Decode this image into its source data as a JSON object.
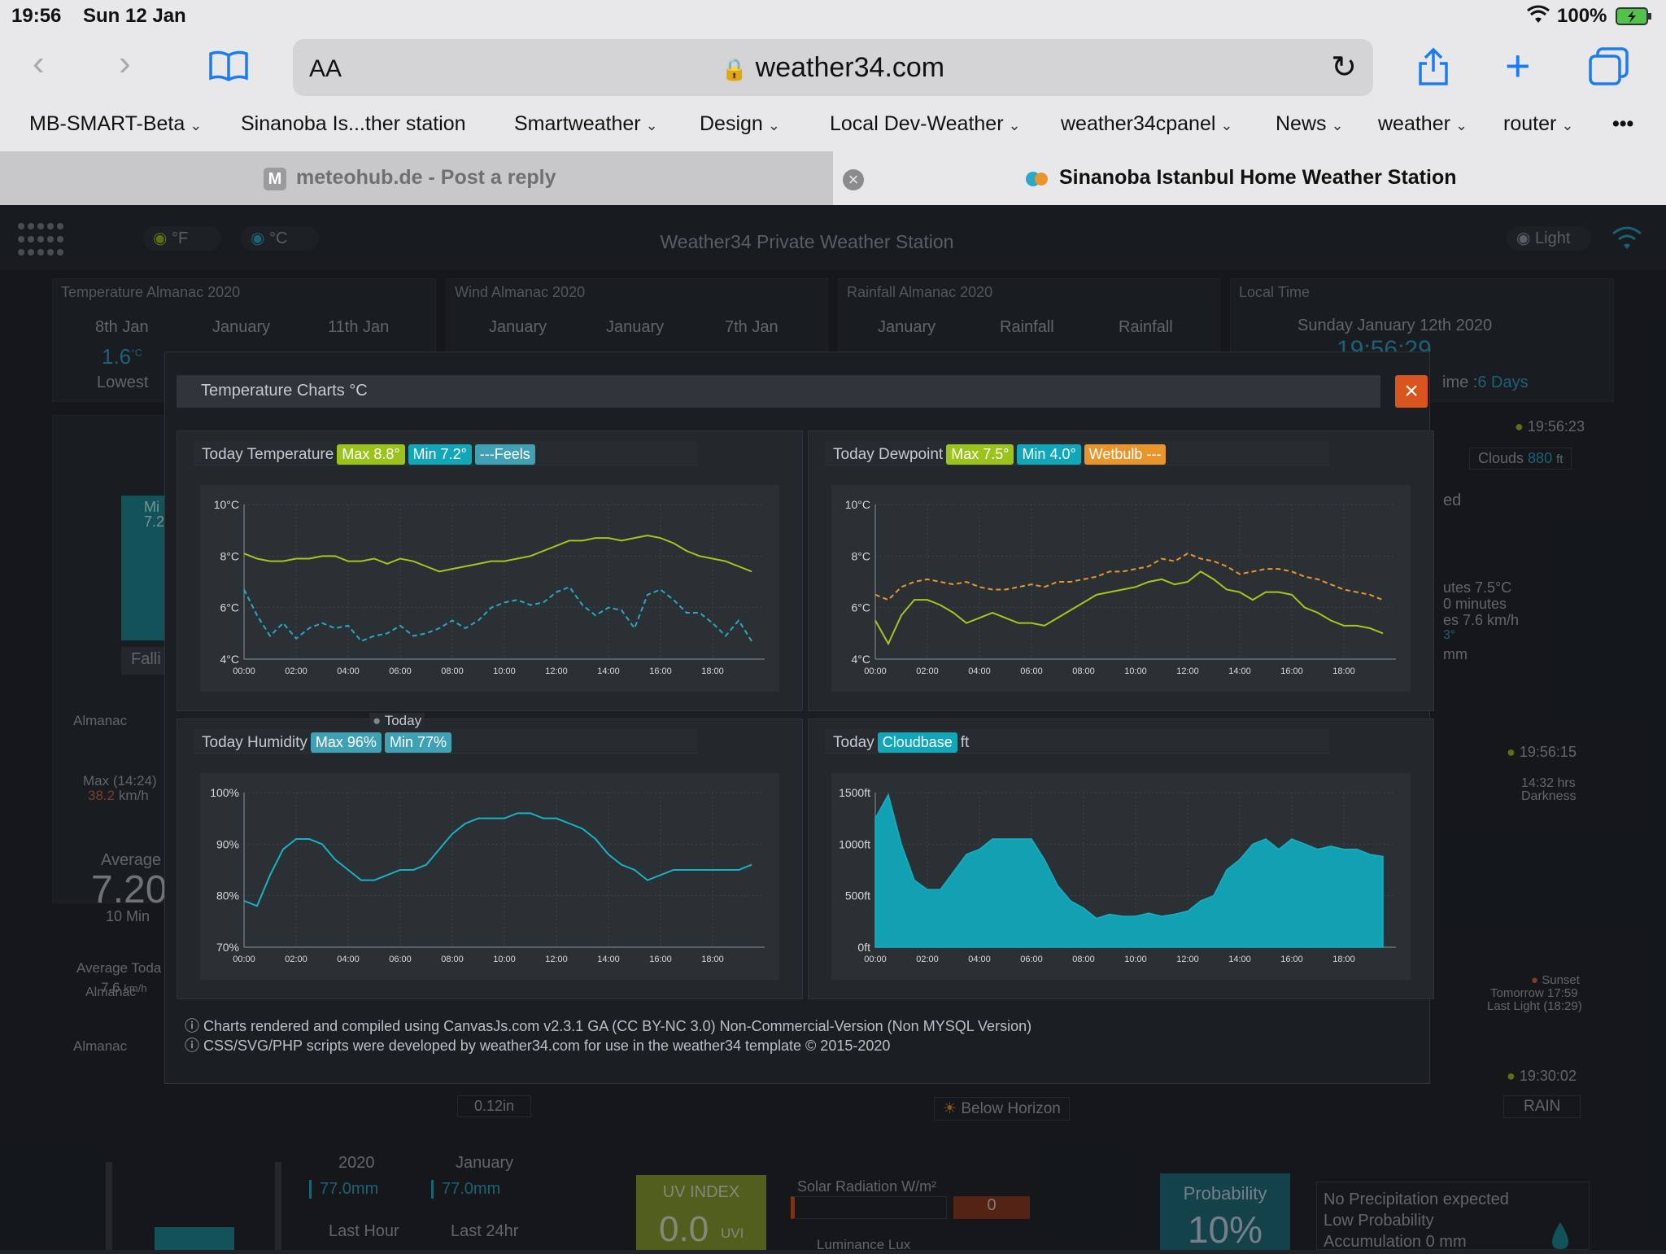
{
  "status": {
    "time": "19:56",
    "date": "Sun 12 Jan",
    "battery": "100%"
  },
  "browser": {
    "url": "weather34.com",
    "text_size_label": "AA",
    "bookmarks": [
      {
        "label": "MB-SMART-Beta",
        "chevron": true
      },
      {
        "label": "Sinanoba Is...ther station",
        "chevron": false
      },
      {
        "label": "Smartweather",
        "chevron": true
      },
      {
        "label": "Design",
        "chevron": true
      },
      {
        "label": "Local Dev-Weather",
        "chevron": true
      },
      {
        "label": "weather34cpanel",
        "chevron": true
      },
      {
        "label": "News",
        "chevron": true
      },
      {
        "label": "weather",
        "chevron": true
      },
      {
        "label": "router",
        "chevron": true
      }
    ],
    "more_label": "•••",
    "tabs": [
      {
        "label": "meteohub.de - Post a reply",
        "icon_letter": "M",
        "active": false
      },
      {
        "label": "Sinanoba Istanbul Home Weather Station",
        "active": true
      }
    ]
  },
  "dashboard": {
    "title": "Weather34 Private Weather Station",
    "unit_f": "°F",
    "unit_c": "°C",
    "theme_label": "Light",
    "panels": [
      {
        "title": "Temperature Almanac 2020",
        "cols": [
          "8th Jan",
          "January",
          "11th Jan"
        ],
        "value": "1.6",
        "unit": "°C",
        "note": "Lowest"
      },
      {
        "title": "Wind Almanac 2020",
        "cols": [
          "January",
          "January",
          "7th Jan"
        ]
      },
      {
        "title": "Rainfall Almanac 2020",
        "cols": [
          "January",
          "Rainfall",
          "Rainfall"
        ]
      },
      {
        "title": "Local Time",
        "date": "Sunday January 12th 2020",
        "time": "19:56:29",
        "uptime_label": "ime :",
        "uptime_value": "6 Days"
      }
    ],
    "side": {
      "time1": "19:56:23",
      "clouds_label": "Clouds",
      "clouds_value": "880",
      "clouds_unit": "ft",
      "ed": "ed",
      "lines": [
        "utes 7.5°C",
        "0 minutes",
        "es 7.6 km/h",
        "3°",
        "mm"
      ],
      "time2": "19:56:15",
      "darkness": "14:32 hrs",
      "darkness_label": "Darkness",
      "sunset_label": "Sunset",
      "sunset_tomorrow": "Tomorrow 17:59",
      "last_light": "Last Light (18:29)",
      "time3": "19:30:02",
      "rain_label": "RAIN"
    },
    "left": {
      "almanac": "Almanac",
      "falling": "Falli",
      "mi": "Mi",
      "mi_val": "7.2",
      "max_label": "Max (14:24)",
      "max_value": "38.2",
      "max_unit": "km/h",
      "avg_label": "Average",
      "avg_value": "7.20",
      "avg_period": "10 Min",
      "avg_today_label": "Average Toda",
      "avg_today_value": "7.6",
      "avg_today_unit": "km/h",
      "almanac2": "Almanac"
    },
    "bottom": {
      "rain_in": "0.12in",
      "year": "2020",
      "month": "January",
      "year_val": "77.0mm",
      "month_val": "77.0mm",
      "last_hour": "Last Hour",
      "last_24": "Last 24hr",
      "below_horizon": "Below Horizon",
      "uv_label": "UV INDEX",
      "uv_value": "0.0",
      "uv_unit": "UVI",
      "solar_label": "Solar Radiation W/m²",
      "solar_value": "0",
      "lux_label": "Luminance Lux",
      "prob_label": "Probability",
      "prob_value": "10%",
      "precip_line": "No Precipitation expected",
      "low_prob": "Low Probability",
      "accum": "Accumulation 0 mm"
    }
  },
  "modal": {
    "title": "Temperature Charts °C",
    "close": "×",
    "today_label": "Today",
    "footnotes": [
      "ⓘ Charts rendered and compiled using CanvasJs.com v2.3.1 GA (CC BY-NC 3.0) Non-Commercial-Version (Non MYSQL Version)",
      "ⓘ CSS/SVG/PHP scripts were developed by weather34.com for use in the weather34 template © 2015-2020"
    ],
    "charts": [
      {
        "caption": "Today Temperature",
        "badges": [
          {
            "text": "Max 8.8°",
            "color": "#9ac31c"
          },
          {
            "text": "Min 7.2°",
            "color": "#12a6b9"
          },
          {
            "text": "---Feels",
            "color": "#3fa1b3"
          }
        ]
      },
      {
        "caption": "Today Dewpoint",
        "badges": [
          {
            "text": "Max 7.5°",
            "color": "#9ac31c"
          },
          {
            "text": "Min 4.0°",
            "color": "#12a6b9"
          },
          {
            "text": "Wetbulb ---",
            "color": "#e8962c"
          }
        ]
      },
      {
        "caption": "Today Humidity",
        "badges": [
          {
            "text": "Max 96%",
            "color": "#3fa1b3"
          },
          {
            "text": "Min 77%",
            "color": "#3fa1b3"
          }
        ]
      },
      {
        "caption": "Today",
        "badges": [
          {
            "text": "Cloudbase",
            "color": "#12a6b9"
          }
        ],
        "suffix": "ft"
      }
    ]
  },
  "chart_data": [
    {
      "type": "line",
      "y_ticks": [
        "4°C",
        "6°C",
        "8°C",
        "10°C"
      ],
      "ylim": [
        4,
        10
      ],
      "x_ticks": [
        "00:00",
        "02:00",
        "04:00",
        "06:00",
        "08:00",
        "10:00",
        "12:00",
        "14:00",
        "16:00",
        "18:00"
      ],
      "x": [
        0,
        0.5,
        1,
        1.5,
        2,
        2.5,
        3,
        3.5,
        4,
        4.5,
        5,
        5.5,
        6,
        6.5,
        7,
        7.5,
        8,
        8.5,
        9,
        9.5,
        10,
        10.5,
        11,
        11.5,
        12,
        12.5,
        13,
        13.5,
        14,
        14.5,
        15,
        15.5,
        16,
        16.5,
        17,
        17.5,
        18,
        18.5,
        19,
        19.5
      ],
      "series": [
        {
          "color": "#a7c51a",
          "dashed": false,
          "values": [
            8.1,
            7.9,
            7.8,
            7.8,
            7.9,
            7.9,
            8.0,
            8.0,
            7.8,
            7.8,
            7.9,
            7.7,
            7.9,
            7.8,
            7.6,
            7.4,
            7.5,
            7.6,
            7.7,
            7.8,
            7.8,
            7.9,
            8.0,
            8.2,
            8.4,
            8.6,
            8.6,
            8.7,
            8.7,
            8.6,
            8.7,
            8.8,
            8.7,
            8.5,
            8.2,
            8.0,
            7.9,
            7.8,
            7.6,
            7.4
          ]
        },
        {
          "color": "#2aa8c0",
          "dashed": true,
          "values": [
            6.7,
            5.7,
            4.9,
            5.4,
            4.8,
            5.2,
            5.4,
            5.2,
            5.3,
            4.7,
            4.9,
            5.0,
            5.3,
            4.9,
            5.0,
            5.2,
            5.5,
            5.2,
            5.5,
            6.0,
            6.2,
            6.3,
            6.1,
            6.2,
            6.6,
            6.8,
            6.1,
            5.7,
            6.0,
            5.9,
            5.2,
            6.5,
            6.7,
            6.3,
            5.8,
            5.8,
            5.4,
            4.9,
            5.5,
            4.7
          ]
        }
      ]
    },
    {
      "type": "line",
      "y_ticks": [
        "4°C",
        "6°C",
        "8°C",
        "10°C"
      ],
      "ylim": [
        4,
        10
      ],
      "x_ticks": [
        "00:00",
        "02:00",
        "04:00",
        "06:00",
        "08:00",
        "10:00",
        "12:00",
        "14:00",
        "16:00",
        "18:00"
      ],
      "x": [
        0,
        0.5,
        1,
        1.5,
        2,
        2.5,
        3,
        3.5,
        4,
        4.5,
        5,
        5.5,
        6,
        6.5,
        7,
        7.5,
        8,
        8.5,
        9,
        9.5,
        10,
        10.5,
        11,
        11.5,
        12,
        12.5,
        13,
        13.5,
        14,
        14.5,
        15,
        15.5,
        16,
        16.5,
        17,
        17.5,
        18,
        18.5,
        19,
        19.5
      ],
      "series": [
        {
          "color": "#e8962c",
          "dashed": true,
          "values": [
            6.5,
            6.3,
            6.8,
            7.0,
            7.1,
            7.0,
            6.9,
            7.0,
            6.8,
            6.7,
            6.7,
            6.8,
            6.9,
            6.8,
            7.0,
            7.0,
            7.1,
            7.2,
            7.4,
            7.4,
            7.5,
            7.6,
            7.9,
            7.8,
            8.1,
            7.9,
            7.8,
            7.6,
            7.3,
            7.4,
            7.5,
            7.5,
            7.4,
            7.2,
            7.1,
            6.9,
            6.7,
            6.6,
            6.5,
            6.3
          ]
        },
        {
          "color": "#a7c51a",
          "dashed": false,
          "values": [
            5.5,
            4.6,
            5.7,
            6.3,
            6.3,
            6.1,
            5.8,
            5.4,
            5.6,
            5.8,
            5.6,
            5.4,
            5.4,
            5.3,
            5.6,
            5.9,
            6.2,
            6.5,
            6.6,
            6.7,
            6.8,
            7.0,
            7.1,
            6.9,
            7.0,
            7.4,
            7.1,
            6.7,
            6.6,
            6.3,
            6.6,
            6.6,
            6.5,
            6.0,
            5.8,
            5.5,
            5.3,
            5.3,
            5.2,
            5.0
          ]
        }
      ]
    },
    {
      "type": "line",
      "y_ticks": [
        "70%",
        "80%",
        "90%",
        "100%"
      ],
      "ylim": [
        70,
        100
      ],
      "x_ticks": [
        "00:00",
        "02:00",
        "04:00",
        "06:00",
        "08:00",
        "10:00",
        "12:00",
        "14:00",
        "16:00",
        "18:00"
      ],
      "x": [
        0,
        0.5,
        1,
        1.5,
        2,
        2.5,
        3,
        3.5,
        4,
        4.5,
        5,
        5.5,
        6,
        6.5,
        7,
        7.5,
        8,
        8.5,
        9,
        9.5,
        10,
        10.5,
        11,
        11.5,
        12,
        12.5,
        13,
        13.5,
        14,
        14.5,
        15,
        15.5,
        16,
        16.5,
        17,
        17.5,
        18,
        18.5,
        19,
        19.5
      ],
      "series": [
        {
          "color": "#19b2c4",
          "dashed": false,
          "values": [
            79,
            78,
            84,
            89,
            91,
            91,
            90,
            87,
            85,
            83,
            83,
            84,
            85,
            85,
            86,
            89,
            92,
            94,
            95,
            95,
            95,
            96,
            96,
            95,
            95,
            94,
            93,
            91,
            88,
            86,
            85,
            83,
            84,
            85,
            85,
            85,
            85,
            85,
            85,
            86
          ]
        }
      ]
    },
    {
      "type": "area",
      "y_ticks": [
        "0ft",
        "500ft",
        "1000ft",
        "1500ft"
      ],
      "ylim": [
        0,
        1500
      ],
      "x_ticks": [
        "00:00",
        "02:00",
        "04:00",
        "06:00",
        "08:00",
        "10:00",
        "12:00",
        "14:00",
        "16:00",
        "18:00"
      ],
      "x": [
        0,
        0.5,
        1,
        1.5,
        2,
        2.5,
        3,
        3.5,
        4,
        4.5,
        5,
        5.5,
        6,
        6.5,
        7,
        7.5,
        8,
        8.5,
        9,
        9.5,
        10,
        10.5,
        11,
        11.5,
        12,
        12.5,
        13,
        13.5,
        14,
        14.5,
        15,
        15.5,
        16,
        16.5,
        17,
        17.5,
        18,
        18.5,
        19,
        19.5
      ],
      "series": [
        {
          "color": "#12a0b3",
          "values": [
            1250,
            1480,
            1000,
            650,
            560,
            560,
            730,
            900,
            950,
            1050,
            1050,
            1050,
            1050,
            850,
            600,
            450,
            380,
            280,
            320,
            300,
            300,
            330,
            300,
            320,
            350,
            450,
            500,
            750,
            850,
            1000,
            1050,
            950,
            1050,
            1000,
            950,
            980,
            950,
            950,
            900,
            880
          ]
        }
      ]
    }
  ]
}
